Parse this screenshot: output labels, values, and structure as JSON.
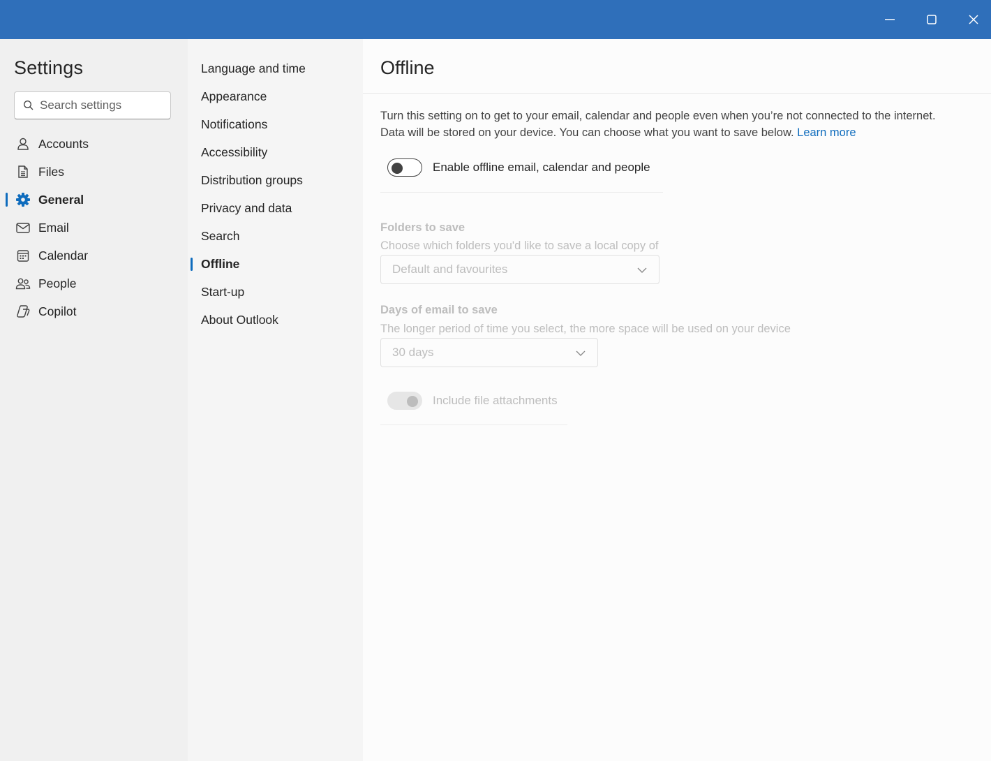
{
  "window": {
    "controls": {
      "minimize": "minimize-icon",
      "maximize": "maximize-icon",
      "close": "close-icon"
    },
    "titlebar_color": "#2f6fba"
  },
  "sidebar": {
    "title": "Settings",
    "search_placeholder": "Search settings",
    "items": [
      {
        "label": "Accounts",
        "icon": "person-icon"
      },
      {
        "label": "Files",
        "icon": "document-icon"
      },
      {
        "label": "General",
        "icon": "gear-icon",
        "active": true
      },
      {
        "label": "Email",
        "icon": "mail-icon"
      },
      {
        "label": "Calendar",
        "icon": "calendar-icon"
      },
      {
        "label": "People",
        "icon": "people-icon"
      },
      {
        "label": "Copilot",
        "icon": "copilot-icon"
      }
    ]
  },
  "subnav": {
    "items": [
      {
        "label": "Language and time"
      },
      {
        "label": "Appearance"
      },
      {
        "label": "Notifications"
      },
      {
        "label": "Accessibility"
      },
      {
        "label": "Distribution groups"
      },
      {
        "label": "Privacy and data"
      },
      {
        "label": "Search"
      },
      {
        "label": "Offline",
        "active": true
      },
      {
        "label": "Start-up"
      },
      {
        "label": "About Outlook"
      }
    ]
  },
  "main": {
    "title": "Offline",
    "description": "Turn this setting on to get to your email, calendar and people even when you’re not connected to the internet. Data will be stored on your device. You can choose what you want to save below.",
    "learn_more": "Learn more",
    "enable_toggle": {
      "label": "Enable offline email, calendar and people",
      "state": "off"
    },
    "folders": {
      "title": "Folders to save",
      "description": "Choose which folders you'd like to save a local copy of",
      "selected": "Default and favourites"
    },
    "days": {
      "title": "Days of email to save",
      "description": "The longer period of time you select, the more space will be used on your device",
      "selected": "30 days"
    },
    "attachments_toggle": {
      "label": "Include file attachments",
      "state": "on-disabled"
    }
  },
  "colors": {
    "accent": "#0f6cbd",
    "disabled_text": "#bdbdbd"
  }
}
